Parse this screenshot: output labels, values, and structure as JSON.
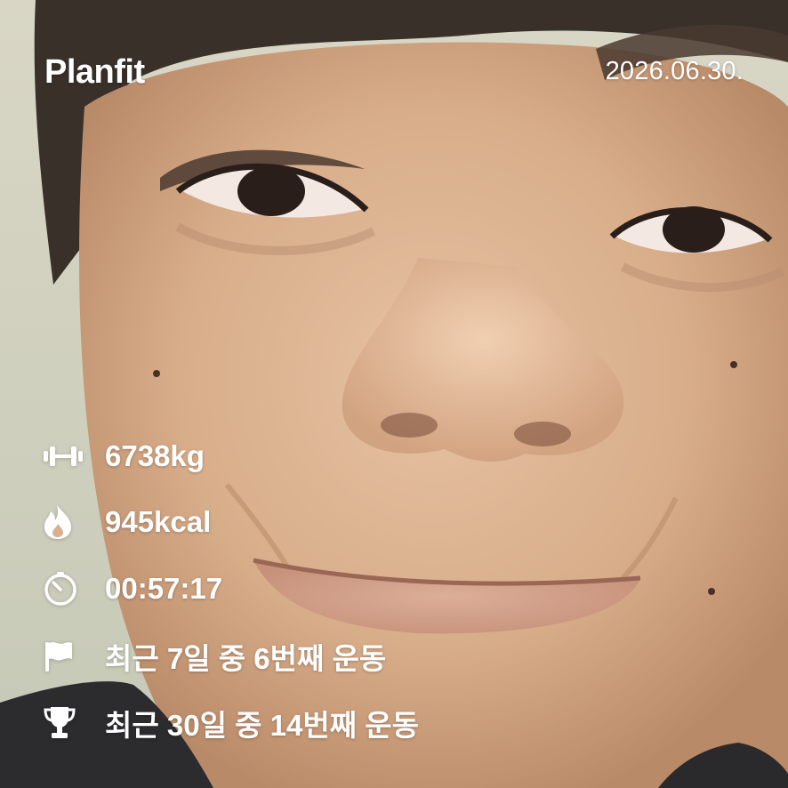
{
  "header": {
    "brand": "Planfit",
    "date": "2026.06.30."
  },
  "stats": [
    {
      "icon": "dumbbell-icon",
      "value": "6738kg"
    },
    {
      "icon": "flame-icon",
      "value": "945kcal"
    },
    {
      "icon": "stopwatch-icon",
      "value": "00:57:17"
    },
    {
      "icon": "flag-icon",
      "value": "최근 7일 중 6번째 운동"
    },
    {
      "icon": "trophy-icon",
      "value": "최근 30일 중 14번째 운동"
    }
  ],
  "colors": {
    "overlay_text": "#ffffff",
    "skin": "#d9b08e",
    "background_wall": "#cfd2c2"
  }
}
